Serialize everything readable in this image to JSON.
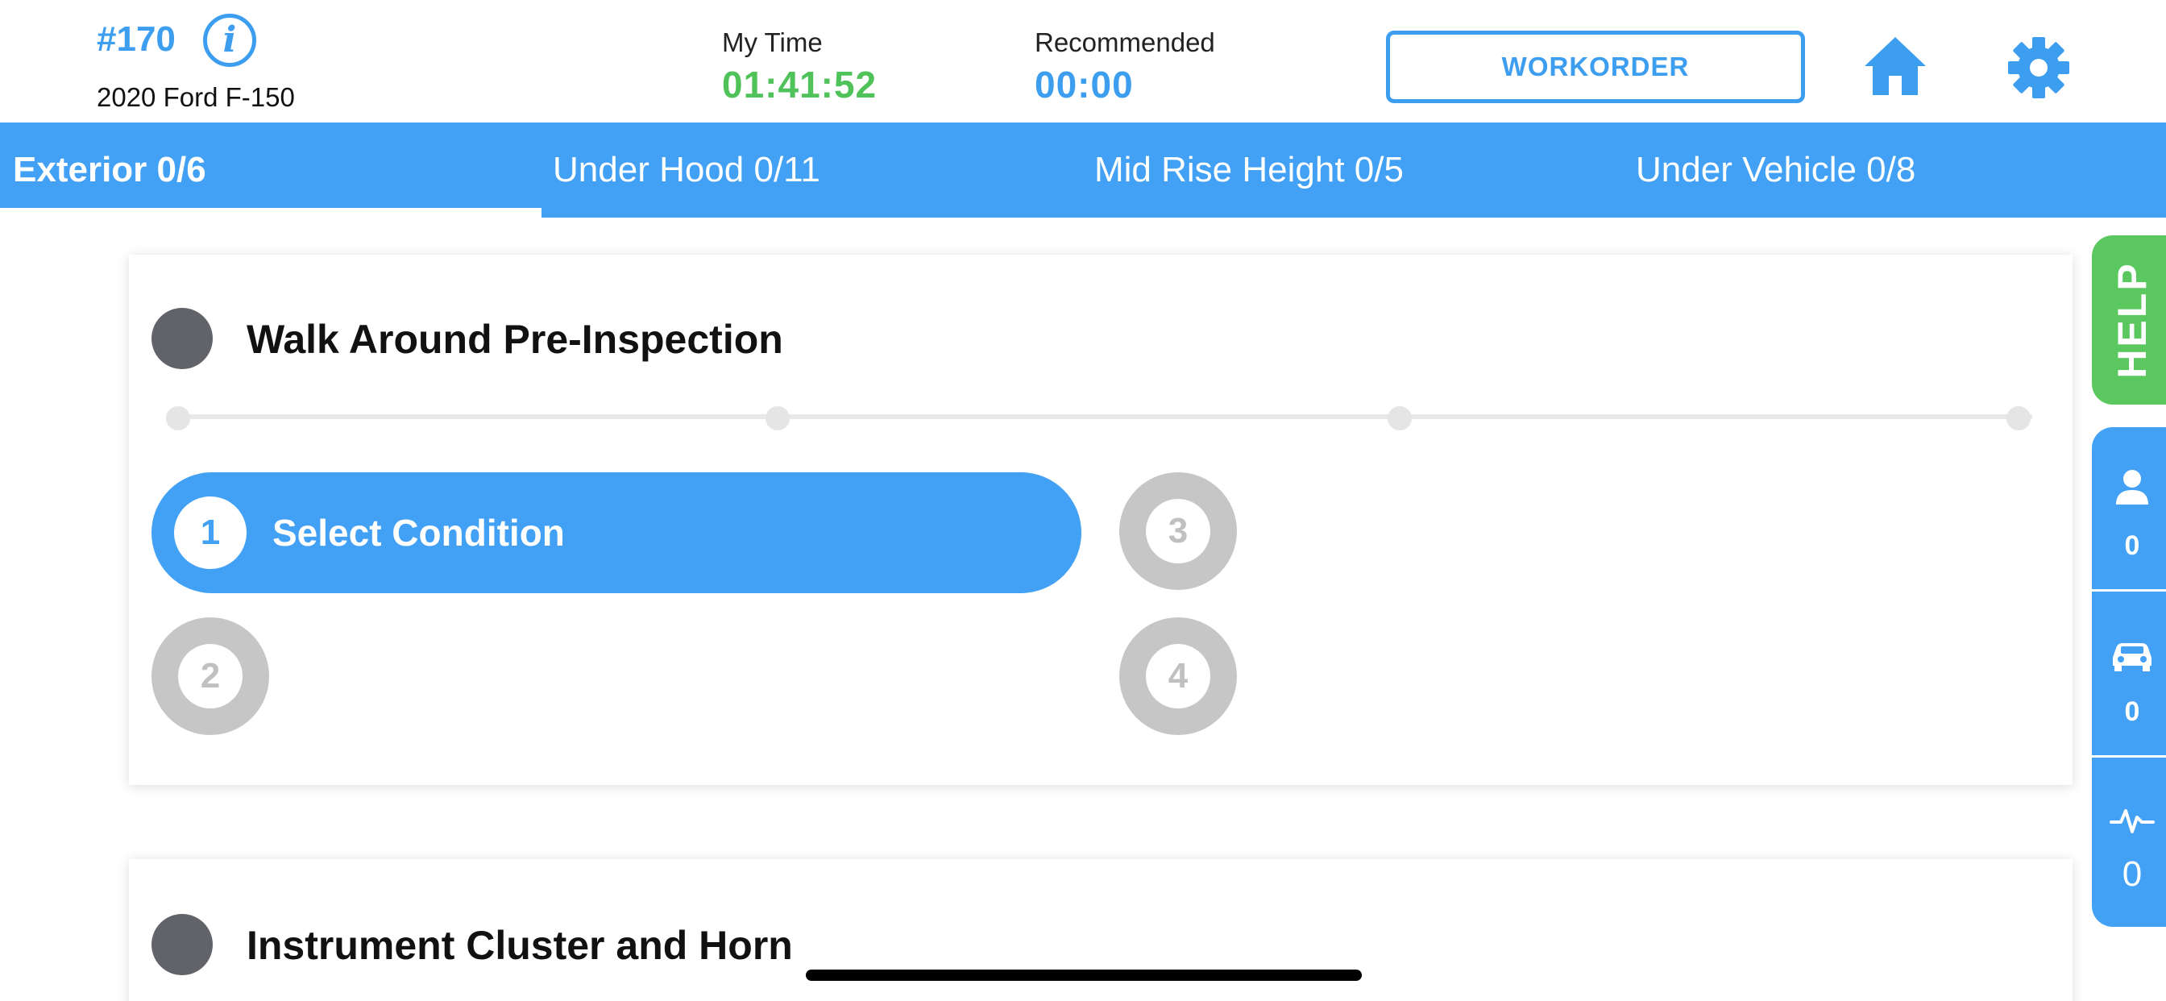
{
  "header": {
    "workorder_number": "#170",
    "vehicle": "2020 Ford F-150",
    "my_time_label": "My Time",
    "my_time_value": "01:41:52",
    "recommended_label": "Recommended",
    "recommended_value": "00:00",
    "workorder_button": "WORKORDER",
    "info_icon_glyph": "i"
  },
  "tabs": [
    {
      "label": "Exterior 0/6",
      "active": true
    },
    {
      "label": "Under Hood 0/11",
      "active": false
    },
    {
      "label": "Mid Rise Height 0/5",
      "active": false
    },
    {
      "label": "Under Vehicle 0/8",
      "active": false
    }
  ],
  "cards": [
    {
      "title": "Walk Around Pre-Inspection",
      "steps": [
        {
          "number": "1",
          "label": "Select Condition",
          "active": true
        },
        {
          "number": "2",
          "label": "",
          "active": false
        },
        {
          "number": "3",
          "label": "",
          "active": false
        },
        {
          "number": "4",
          "label": "",
          "active": false
        }
      ]
    },
    {
      "title": "Instrument Cluster and Horn"
    }
  ],
  "side_panel": {
    "help_label": "HELP",
    "items": [
      {
        "icon": "person-icon",
        "count": "0"
      },
      {
        "icon": "car-icon",
        "count": "0"
      },
      {
        "icon": "pulse-icon",
        "count": "0"
      }
    ]
  },
  "colors": {
    "accent": "#42a1f4",
    "green": "#4fc25a",
    "help_green": "#5bc75f",
    "status_dot": "#616369",
    "inactive_step": "#c6c6c6"
  }
}
